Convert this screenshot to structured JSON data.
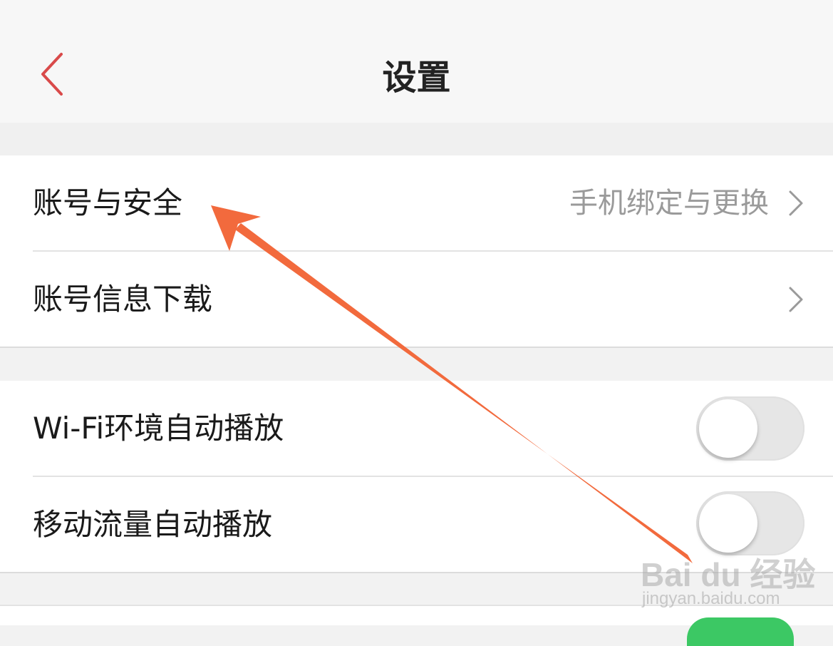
{
  "header": {
    "title": "设置",
    "back_icon": "chevron-left-icon",
    "back_color": "#d94a4a"
  },
  "group1": {
    "items": [
      {
        "label": "账号与安全",
        "value": "手机绑定与更换",
        "icon": "chevron-right-icon"
      },
      {
        "label": "账号信息下载",
        "icon": "chevron-right-icon"
      }
    ]
  },
  "group2": {
    "items": [
      {
        "label": "Wi-Fi环境自动播放",
        "toggle_on": false
      },
      {
        "label": "移动流量自动播放",
        "toggle_on": false
      }
    ]
  },
  "group3": {
    "toggle_on": true,
    "toggle_color": "#3cc864"
  },
  "annotation": {
    "arrow_color": "#f26a3d"
  },
  "watermark": {
    "logo": "Bai du 经验",
    "url": "jingyan.baidu.com"
  }
}
